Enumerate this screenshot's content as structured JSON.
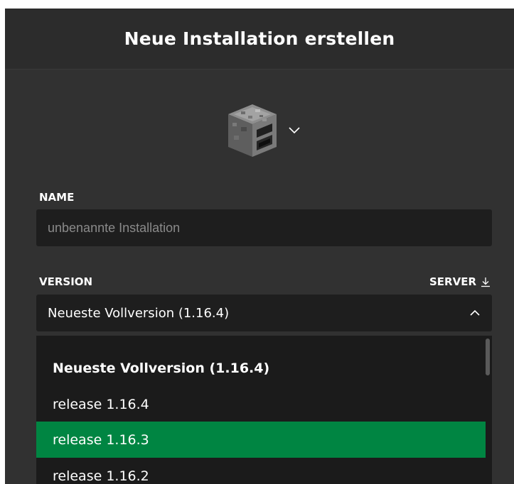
{
  "dialog": {
    "title": "Neue Installation erstellen"
  },
  "icon_picker": {
    "icon": "furnace-icon"
  },
  "name_field": {
    "label": "NAME",
    "value": "",
    "placeholder": "unbenannte Installation"
  },
  "version_field": {
    "label": "VERSION",
    "server_label": "SERVER",
    "selected": "Neueste Vollversion (1.16.4)"
  },
  "dropdown": {
    "items": [
      {
        "label": "Neueste Vollversion (1.16.4)",
        "type": "header"
      },
      {
        "label": "release 1.16.4",
        "type": "option"
      },
      {
        "label": "release 1.16.3",
        "type": "option",
        "highlighted": true
      },
      {
        "label": "release 1.16.2",
        "type": "option"
      }
    ]
  },
  "colors": {
    "background": "#313131",
    "field_background": "#1e1e1e",
    "highlight": "#008542",
    "text": "#ffffff",
    "placeholder": "#8a8a8a"
  }
}
